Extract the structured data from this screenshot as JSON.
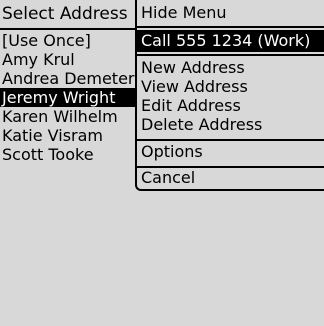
{
  "title_bar": {
    "title": "Select Address"
  },
  "address_list": {
    "items": [
      {
        "label": "[Use Once]"
      },
      {
        "label": "Amy Krul"
      },
      {
        "label": "Andrea Demeter"
      },
      {
        "label": "Jeremy Wright",
        "selected": true
      },
      {
        "label": "Karen Wilhelm"
      },
      {
        "label": "Katie Visram"
      },
      {
        "label": "Scott Tooke"
      }
    ]
  },
  "menu": {
    "items": [
      {
        "label": "Hide Menu"
      },
      {
        "label": "Call 555 1234 (Work)",
        "selected": true
      },
      {
        "label": "New Address"
      },
      {
        "label": "View Address"
      },
      {
        "label": "Edit Address"
      },
      {
        "label": "Delete Address"
      },
      {
        "label": "Options"
      },
      {
        "label": "Cancel"
      }
    ]
  }
}
